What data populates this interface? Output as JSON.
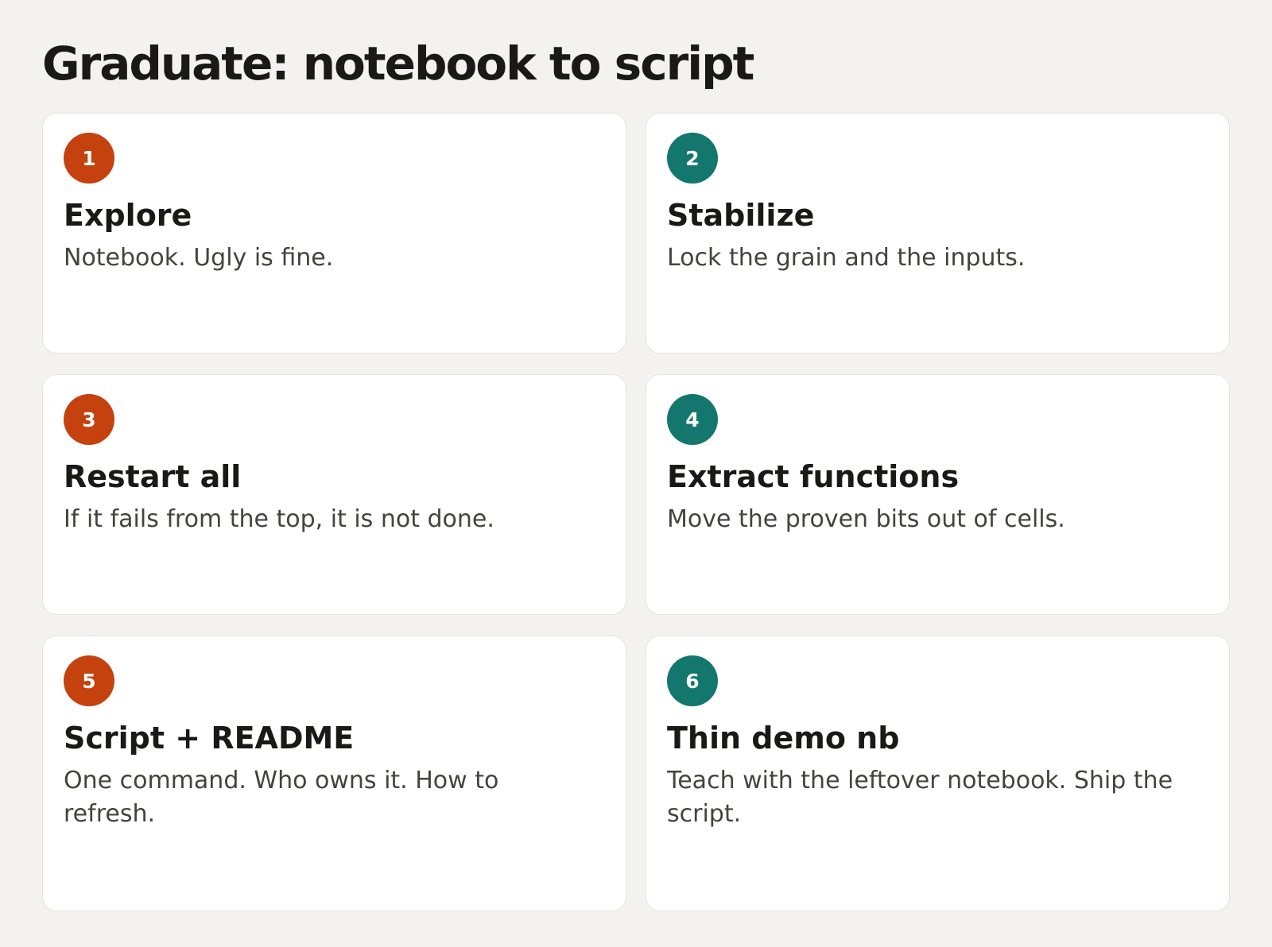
{
  "title": "Graduate: notebook to script",
  "colors": {
    "background": "#f3f2ef",
    "card": "#ffffff",
    "orange": "#c5410d",
    "teal": "#14776e",
    "text": "#1a1917",
    "muted_text": "#45433f"
  },
  "steps": [
    {
      "number": "1",
      "title": "Explore",
      "description": "Notebook. Ugly is fine.",
      "color": "orange"
    },
    {
      "number": "2",
      "title": "Stabilize",
      "description": "Lock the grain and the inputs.",
      "color": "teal"
    },
    {
      "number": "3",
      "title": "Restart all",
      "description": "If it fails from the top, it is not done.",
      "color": "orange"
    },
    {
      "number": "4",
      "title": "Extract functions",
      "description": "Move the proven bits out of cells.",
      "color": "teal"
    },
    {
      "number": "5",
      "title": "Script + README",
      "description": "One command. Who owns it. How to refresh.",
      "color": "orange"
    },
    {
      "number": "6",
      "title": "Thin demo nb",
      "description": "Teach with the leftover notebook. Ship the script.",
      "color": "teal"
    }
  ]
}
